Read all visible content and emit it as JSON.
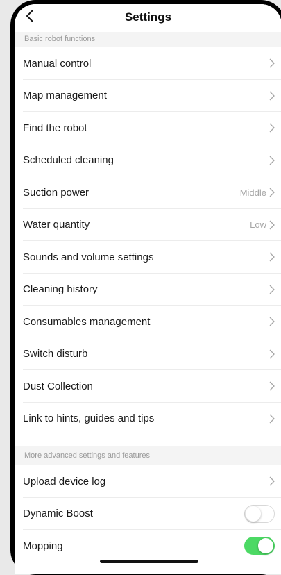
{
  "header": {
    "title": "Settings"
  },
  "sections": [
    {
      "header": "Basic robot functions",
      "items": [
        {
          "label": "Manual control",
          "value": ""
        },
        {
          "label": "Map management",
          "value": ""
        },
        {
          "label": "Find the robot",
          "value": ""
        },
        {
          "label": "Scheduled cleaning",
          "value": ""
        },
        {
          "label": "Suction power",
          "value": "Middle"
        },
        {
          "label": "Water quantity",
          "value": "Low"
        },
        {
          "label": "Sounds and volume settings",
          "value": ""
        },
        {
          "label": "Cleaning history",
          "value": ""
        },
        {
          "label": "Consumables management",
          "value": ""
        },
        {
          "label": "Switch disturb",
          "value": ""
        },
        {
          "label": "Dust Collection",
          "value": ""
        },
        {
          "label": "Link to hints, guides and tips",
          "value": ""
        }
      ]
    },
    {
      "header": "More advanced settings and features",
      "items": [
        {
          "label": "Upload device log"
        },
        {
          "label": "Dynamic Boost",
          "toggle": false
        },
        {
          "label": "Mopping",
          "toggle": true
        }
      ]
    }
  ],
  "colors": {
    "toggle_on": "#4cd964",
    "separator": "#ececec",
    "section_bg": "#f4f4f4"
  }
}
